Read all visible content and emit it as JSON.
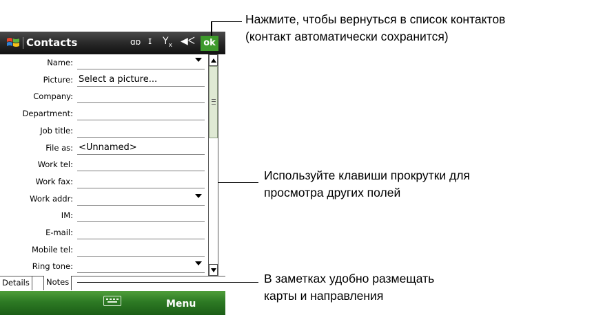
{
  "title_bar": {
    "app_title": "Contacts",
    "ok_label": "ok",
    "icons": [
      "windows-start-icon",
      "bluetooth-icon",
      "battery-icon",
      "signal-off-icon",
      "speaker-icon"
    ]
  },
  "form": {
    "fields": [
      {
        "label": "Name:",
        "value": "",
        "dropdown": true
      },
      {
        "label": "Picture:",
        "value": "Select a picture...",
        "dropdown": false
      },
      {
        "label": "Company:",
        "value": "",
        "dropdown": false
      },
      {
        "label": "Department:",
        "value": "",
        "dropdown": false
      },
      {
        "label": "Job title:",
        "value": "",
        "dropdown": false
      },
      {
        "label": "File as:",
        "value": "<Unnamed>",
        "dropdown": false
      },
      {
        "label": "Work tel:",
        "value": "",
        "dropdown": false
      },
      {
        "label": "Work fax:",
        "value": "",
        "dropdown": false
      },
      {
        "label": "Work addr:",
        "value": "",
        "dropdown": true
      },
      {
        "label": "IM:",
        "value": "",
        "dropdown": false
      },
      {
        "label": "E-mail:",
        "value": "",
        "dropdown": false
      },
      {
        "label": "Mobile tel:",
        "value": "",
        "dropdown": false
      },
      {
        "label": "Ring tone:",
        "value": "",
        "dropdown": true
      }
    ]
  },
  "tabs": [
    {
      "label": "Details",
      "active": false
    },
    {
      "label": "Notes",
      "active": true
    }
  ],
  "menu_bar": {
    "menu_label": "Menu",
    "colors": {
      "accent": "#2d7a24",
      "ok_button": "#3e9a2c"
    }
  },
  "callouts": {
    "ok": "Нажмите, чтобы вернуться в список контактов\n(контакт автоматически сохранится)",
    "scroll": "Используйте клавиши прокрутки для\nпросмотра других полей",
    "notes": "В заметках удобно размещать\nкарты и направления"
  }
}
